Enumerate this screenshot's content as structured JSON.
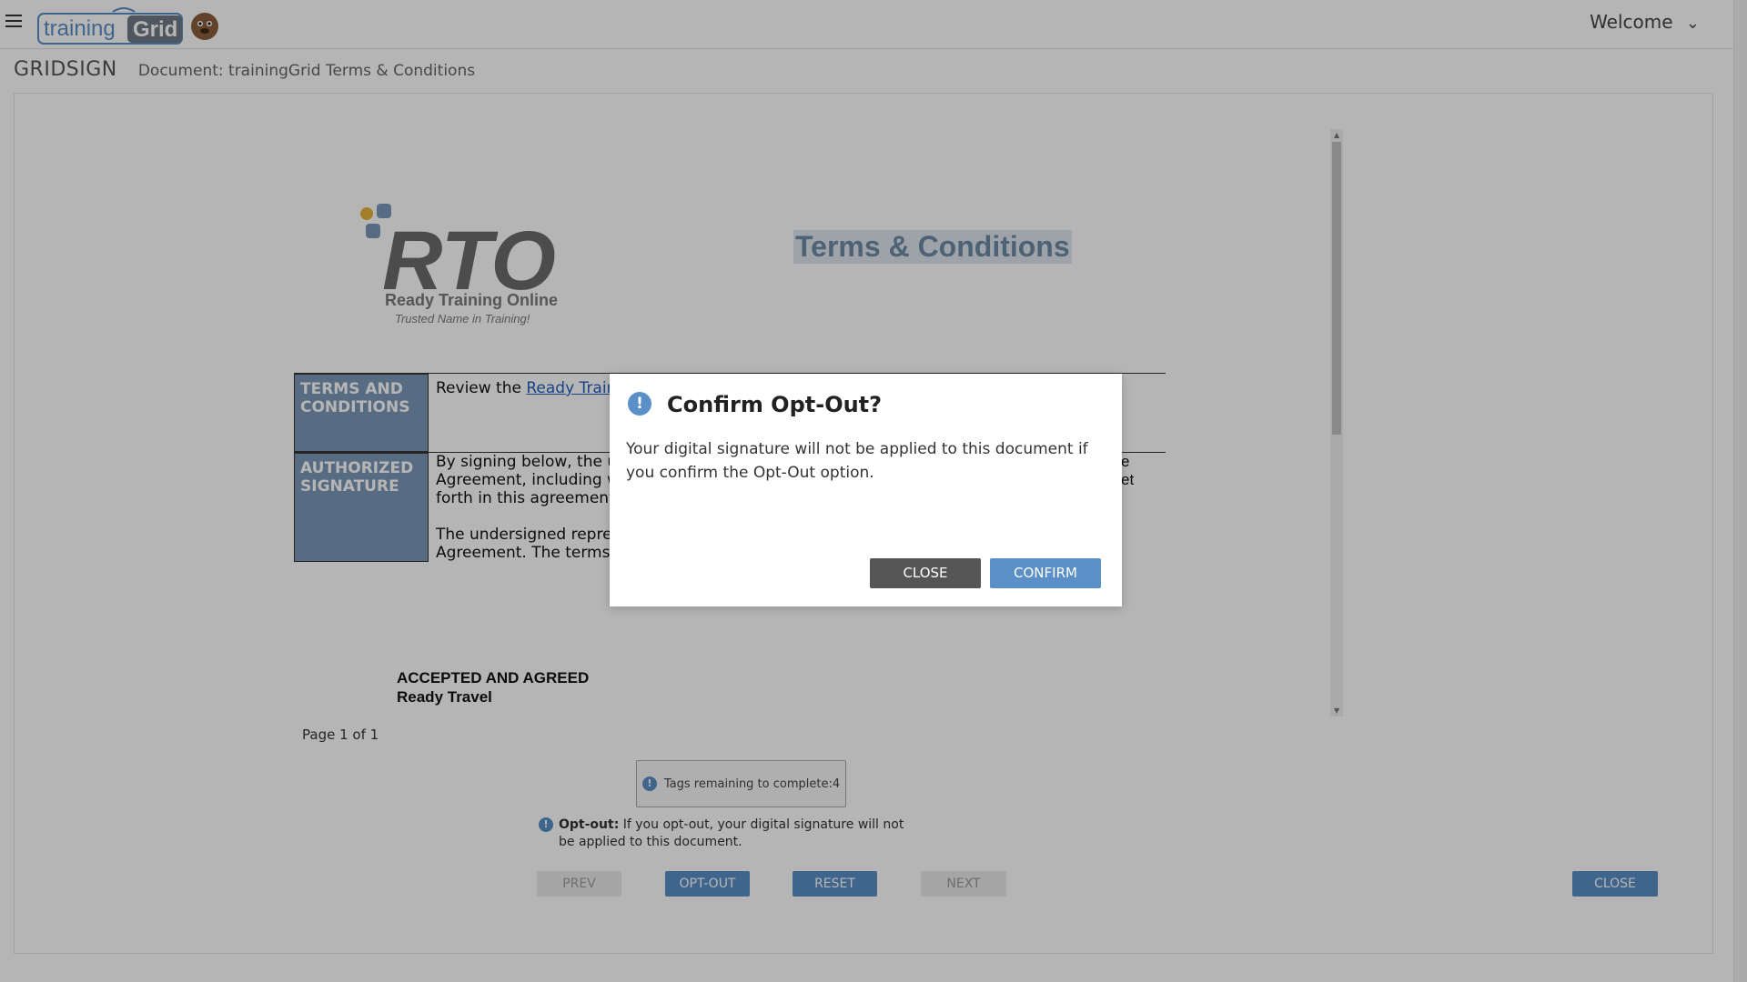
{
  "header": {
    "logo_alt": "trainingGrid",
    "welcome_label": "Welcome"
  },
  "subheader": {
    "app_name": "GRIDSIGN",
    "document_label": "Document: trainingGrid Terms & Conditions"
  },
  "document": {
    "logo_name": "Ready Training Online",
    "logo_tagline": "Trusted Name in Training!",
    "title": "Terms & Conditions",
    "rows": [
      {
        "label": "TERMS AND CONDITIONS",
        "text_prefix": "Review the ",
        "link": "Ready Traini"
      },
      {
        "label": "AUTHORIZED SIGNATURE",
        "text_lines": [
          "By signing below, the und",
          "Agreement, including with",
          "forth in this agreement ar",
          "",
          "The undersigned represe",
          "Agreement. The terms of"
        ],
        "right_fragments": [
          "e",
          "et"
        ]
      }
    ],
    "accepted_line1": "ACCEPTED AND AGREED",
    "accepted_line2": "Ready Travel"
  },
  "page_indicator": "Page 1 of 1",
  "tags_remaining": "Tags remaining to complete:4",
  "optout_note": {
    "bold": "Opt-out:",
    "text": " If you opt-out, your digital signature will not be applied to this document."
  },
  "buttons": {
    "prev": "PREV",
    "opt_out": "OPT-OUT",
    "reset": "RESET",
    "next": "NEXT",
    "close": "CLOSE"
  },
  "modal": {
    "title": "Confirm Opt-Out?",
    "body": "Your digital signature will not be applied to this document if you confirm the Opt-Out option.",
    "close_label": "CLOSE",
    "confirm_label": "CONFIRM"
  },
  "colors": {
    "accent": "#5b8fc7",
    "table_label_bg": "#7b98b7",
    "overlay": "rgba(0,0,0,0.29)"
  }
}
